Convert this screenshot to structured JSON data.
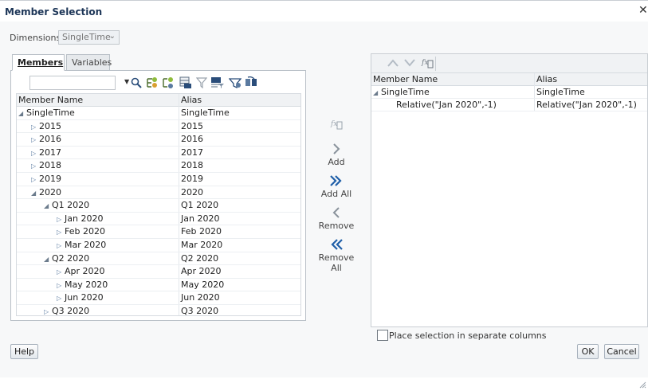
{
  "dialog": {
    "title": "Member Selection"
  },
  "dimensions": {
    "label": "Dimensions",
    "selected": "SingleTime"
  },
  "tabs": {
    "members": "Members",
    "variables": "Variables"
  },
  "left_grid": {
    "headers": {
      "name": "Member Name",
      "alias": "Alias"
    },
    "rows": [
      {
        "name": "SingleTime",
        "alias": "SingleTime"
      },
      {
        "name": "2015",
        "alias": "2015"
      },
      {
        "name": "2016",
        "alias": "2016"
      },
      {
        "name": "2017",
        "alias": "2017"
      },
      {
        "name": "2018",
        "alias": "2018"
      },
      {
        "name": "2019",
        "alias": "2019"
      },
      {
        "name": "2020",
        "alias": "2020"
      },
      {
        "name": "Q1 2020",
        "alias": "Q1 2020"
      },
      {
        "name": "Jan 2020",
        "alias": "Jan 2020"
      },
      {
        "name": "Feb 2020",
        "alias": "Feb 2020"
      },
      {
        "name": "Mar 2020",
        "alias": "Mar 2020"
      },
      {
        "name": "Q2 2020",
        "alias": "Q2 2020"
      },
      {
        "name": "Apr 2020",
        "alias": "Apr 2020"
      },
      {
        "name": "May 2020",
        "alias": "May 2020"
      },
      {
        "name": "Jun 2020",
        "alias": "Jun 2020"
      },
      {
        "name": "Q3 2020",
        "alias": "Q3 2020"
      }
    ]
  },
  "actions": {
    "add": "Add",
    "add_all": "Add All",
    "remove": "Remove",
    "remove_all": "Remove All"
  },
  "right_grid": {
    "headers": {
      "name": "Member Name",
      "alias": "Alias"
    },
    "rows": [
      {
        "name": "SingleTime",
        "alias": "SingleTime"
      },
      {
        "name": "Relative(\"Jan 2020\",-1)",
        "alias": "Relative(\"Jan 2020\",-1)"
      }
    ]
  },
  "options": {
    "separate_columns": "Place selection in separate columns"
  },
  "buttons": {
    "help": "Help",
    "ok": "OK",
    "cancel": "Cancel"
  }
}
